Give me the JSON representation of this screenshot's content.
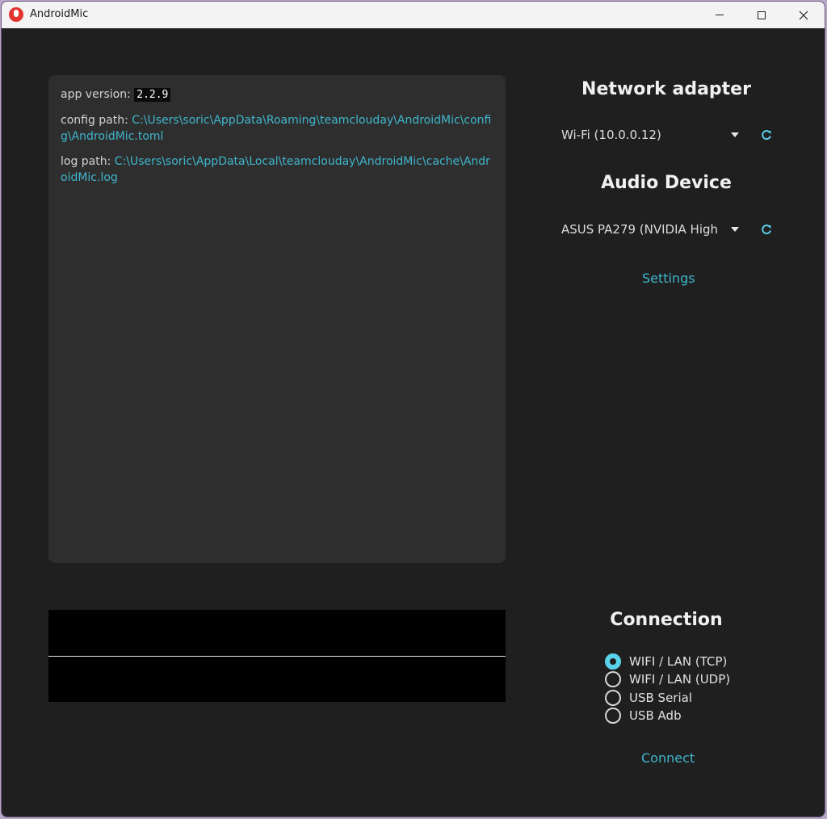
{
  "window": {
    "title": "AndroidMic"
  },
  "info": {
    "app_version_label": "app version: ",
    "app_version": "2.2.9",
    "config_path_label": "config path: ",
    "config_path": "C:\\Users\\soric\\AppData\\Roaming\\teamclouday\\AndroidMic\\config\\AndroidMic.toml",
    "log_path_label": "log path: ",
    "log_path": "C:\\Users\\soric\\AppData\\Local\\teamclouday\\AndroidMic\\cache\\AndroidMic.log"
  },
  "network": {
    "heading": "Network adapter",
    "selected": "Wi-Fi (10.0.0.12)"
  },
  "audio": {
    "heading": "Audio Device",
    "selected": "ASUS PA279 (NVIDIA High",
    "settings_label": "Settings"
  },
  "connection": {
    "heading": "Connection",
    "options": [
      "WIFI / LAN (TCP)",
      "WIFI / LAN (UDP)",
      "USB Serial",
      "USB Adb"
    ],
    "selected_index": 0,
    "connect_label": "Connect"
  },
  "colors": {
    "accent": "#3fb6cc",
    "radio_accent": "#5ad1ea",
    "background": "#1f1f1f",
    "panel": "#2e2e2e"
  },
  "icons": {
    "refresh": "refresh-icon",
    "dropdown": "caret-down-icon"
  }
}
